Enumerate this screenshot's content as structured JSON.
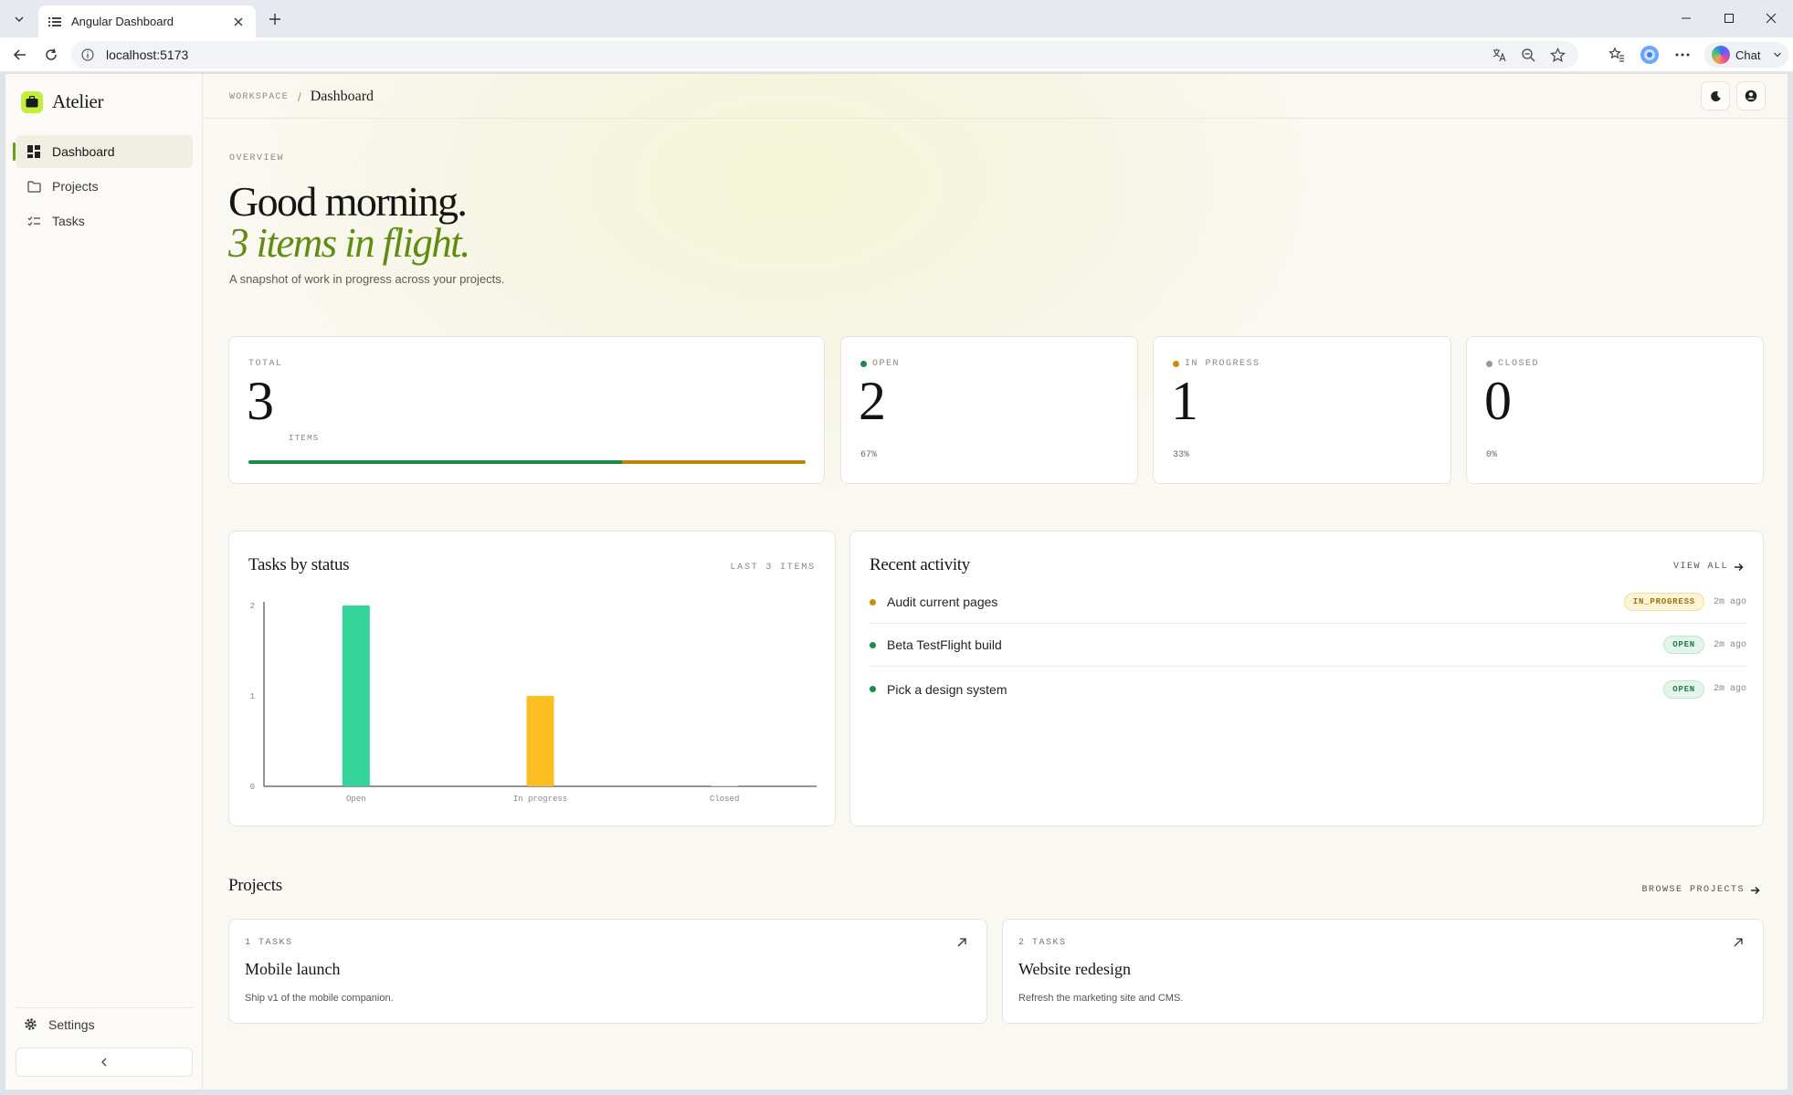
{
  "browser": {
    "tab_title": "Angular Dashboard",
    "url": "localhost:5173",
    "chat_label": "Chat"
  },
  "app": {
    "brand": "Atelier",
    "nav": [
      {
        "label": "Dashboard",
        "icon": "grid-icon",
        "active": true
      },
      {
        "label": "Projects",
        "icon": "folder-icon",
        "active": false
      },
      {
        "label": "Tasks",
        "icon": "checklist-icon",
        "active": false
      }
    ],
    "settings_label": "Settings"
  },
  "topbar": {
    "workspace": "WORKSPACE",
    "separator": "/",
    "page": "Dashboard"
  },
  "hero": {
    "eyebrow": "OVERVIEW",
    "greeting": "Good morning.",
    "in_flight": "3 items in flight.",
    "subtitle": "A snapshot of work in progress across your projects."
  },
  "stats": {
    "total": {
      "label": "TOTAL",
      "value": "3",
      "unit": "ITEMS"
    },
    "open": {
      "label": "OPEN",
      "value": "2",
      "pct": "67%",
      "color": "#1c8a4e"
    },
    "in_progress": {
      "label": "IN PROGRESS",
      "value": "1",
      "pct": "33%",
      "color": "#b8860b"
    },
    "closed": {
      "label": "CLOSED",
      "value": "0",
      "pct": "0%",
      "color": "#9a978e"
    },
    "progress_fractions": [
      0.67,
      0.33,
      0
    ]
  },
  "chart_card": {
    "title": "Tasks by status",
    "meta": "LAST 3 ITEMS"
  },
  "chart_data": {
    "type": "bar",
    "categories": [
      "Open",
      "In progress",
      "Closed"
    ],
    "values": [
      2,
      1,
      0
    ],
    "colors": [
      "#34d399",
      "#fbbf24",
      "#9ca3af"
    ],
    "yticks": [
      "0",
      "1",
      "2"
    ],
    "ylim": [
      0,
      2
    ],
    "grid": false
  },
  "activity": {
    "title": "Recent activity",
    "view_all": "VIEW ALL",
    "items": [
      {
        "title": "Audit current pages",
        "status": "IN_PROGRESS",
        "time": "2m ago",
        "dot": "#c7900c",
        "badge_bg": "#fdf3d7",
        "badge_fg": "#a06f05",
        "badge_border": "#f3dea0"
      },
      {
        "title": "Beta TestFlight build",
        "status": "OPEN",
        "time": "2m ago",
        "dot": "#1c8a4e",
        "badge_bg": "#e3f5ea",
        "badge_fg": "#1e7a48",
        "badge_border": "#bfe6cf"
      },
      {
        "title": "Pick a design system",
        "status": "OPEN",
        "time": "2m ago",
        "dot": "#1c8a4e",
        "badge_bg": "#e3f5ea",
        "badge_fg": "#1e7a48",
        "badge_border": "#bfe6cf"
      }
    ]
  },
  "projects": {
    "title": "Projects",
    "browse": "BROWSE PROJECTS",
    "items": [
      {
        "count": "1 TASKS",
        "name": "Mobile launch",
        "desc": "Ship v1 of the mobile companion."
      },
      {
        "count": "2 TASKS",
        "name": "Website redesign",
        "desc": "Refresh the marketing site and CMS."
      }
    ]
  }
}
